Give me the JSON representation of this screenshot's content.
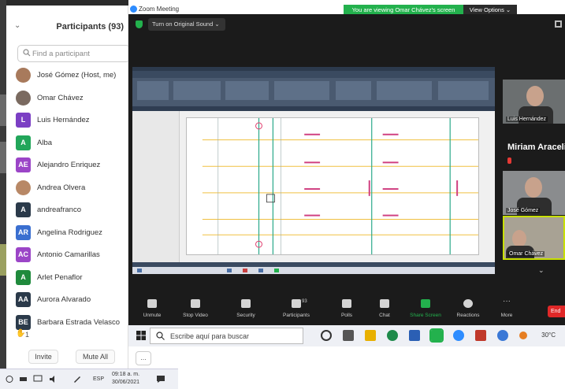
{
  "participants_panel": {
    "title": "Participants (93)",
    "collapse_icon": "chevron-down-icon",
    "search_placeholder": "Find a participant",
    "items": [
      {
        "name": "José Gómez (Host, me)",
        "initials": "",
        "color": "#a87a5c",
        "photo": true
      },
      {
        "name": "Omar Chávez",
        "initials": "",
        "color": "#7a6a60",
        "photo": true
      },
      {
        "name": "Luis Hernández",
        "initials": "L",
        "color": "#7b3fc4",
        "photo": false
      },
      {
        "name": "Alba",
        "initials": "A",
        "color": "#22a65a",
        "photo": false
      },
      {
        "name": "Alejandro Enriquez",
        "initials": "AE",
        "color": "#9b45c7",
        "photo": false
      },
      {
        "name": "Andrea Olvera",
        "initials": "",
        "color": "#b88866",
        "photo": true
      },
      {
        "name": "andreafranco",
        "initials": "A",
        "color": "#2b3a4a",
        "photo": false
      },
      {
        "name": "Angelina Rodriguez",
        "initials": "AR",
        "color": "#3a6fd0",
        "photo": false
      },
      {
        "name": "Antonio Camarillas",
        "initials": "AC",
        "color": "#9b45c7",
        "photo": false
      },
      {
        "name": "Arlet Penaflor",
        "initials": "A",
        "color": "#1f8a3c",
        "photo": false
      },
      {
        "name": "Aurora Alvarado",
        "initials": "AA",
        "color": "#2b3a4a",
        "photo": false
      },
      {
        "name": "Barbara Estrada Velasco",
        "initials": "BE",
        "color": "#2b3a4a",
        "photo": false
      }
    ],
    "raised_hand_count": "1",
    "invite_label": "Invite",
    "mute_all_label": "Mute All",
    "more_label": "..."
  },
  "left_taskbar": {
    "lang": "ESP",
    "time": "09:18 a. m.",
    "date": "30/06/2021"
  },
  "zoom_window": {
    "title": "Zoom Meeting",
    "viewing_banner": "You are viewing Omar Chávez's screen",
    "view_options_label": "View Options ⌄",
    "original_sound_label": "Turn on Original Sound  ⌄",
    "speaker_name": "Miriam  Araceli",
    "video_tiles": [
      {
        "label": "Luis Hernández"
      },
      {
        "label": "José Gómez"
      },
      {
        "label": "Omar Chávez"
      }
    ],
    "colors": {
      "banner_green": "#23b14d",
      "end_red": "#e02828",
      "toolbar_bg": "#1b1b1b"
    }
  },
  "toolbar": {
    "unmute": "Unmute",
    "stop_video": "Stop Video",
    "security": "Security",
    "participants": "Participants",
    "participants_count": "93",
    "polls": "Polls",
    "chat": "Chat",
    "share_screen": "Share Screen",
    "reactions": "Reactions",
    "more": "More",
    "end": "End"
  },
  "main_taskbar": {
    "search_placeholder": "Escribe aquí para buscar",
    "weather": "30°C"
  }
}
